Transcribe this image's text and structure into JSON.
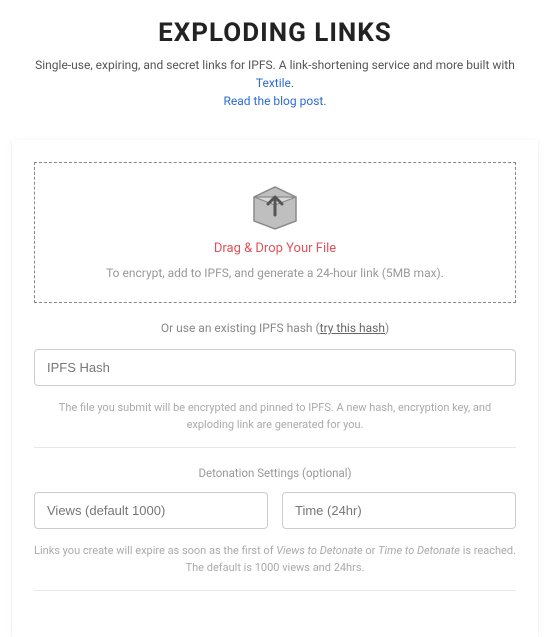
{
  "header": {
    "title": "EXPLODING LINKS",
    "subtitle_pre": "Single-use, expiring, and secret links for IPFS. A link-shortening service and more built with ",
    "subtitle_link": "Textile",
    "subtitle_post": ".",
    "blog_link": "Read the blog post."
  },
  "dropzone": {
    "title": "Drag & Drop Your File",
    "subtitle": "To encrypt, add to IPFS, and generate a 24-hour link (5MB max)."
  },
  "or_line": {
    "pre": "Or use an existing IPFS hash (",
    "link": "try this hash",
    "post": ")"
  },
  "hash_input": {
    "placeholder": "IPFS Hash"
  },
  "hash_help": "The file you submit will be encrypted and pinned to IPFS. A new hash, encryption key, and exploding link are generated for you.",
  "detonation": {
    "label": "Detonation Settings (optional)",
    "views_placeholder": "Views (default 1000)",
    "time_placeholder": "Time (24hr)"
  },
  "footer_help": {
    "pre": "Links you create will expire as soon as the first of ",
    "em1": "Views to Detonate",
    "mid": " or ",
    "em2": "Time to Detonate",
    "post": " is reached. The default is 1000 views and 24hrs."
  }
}
